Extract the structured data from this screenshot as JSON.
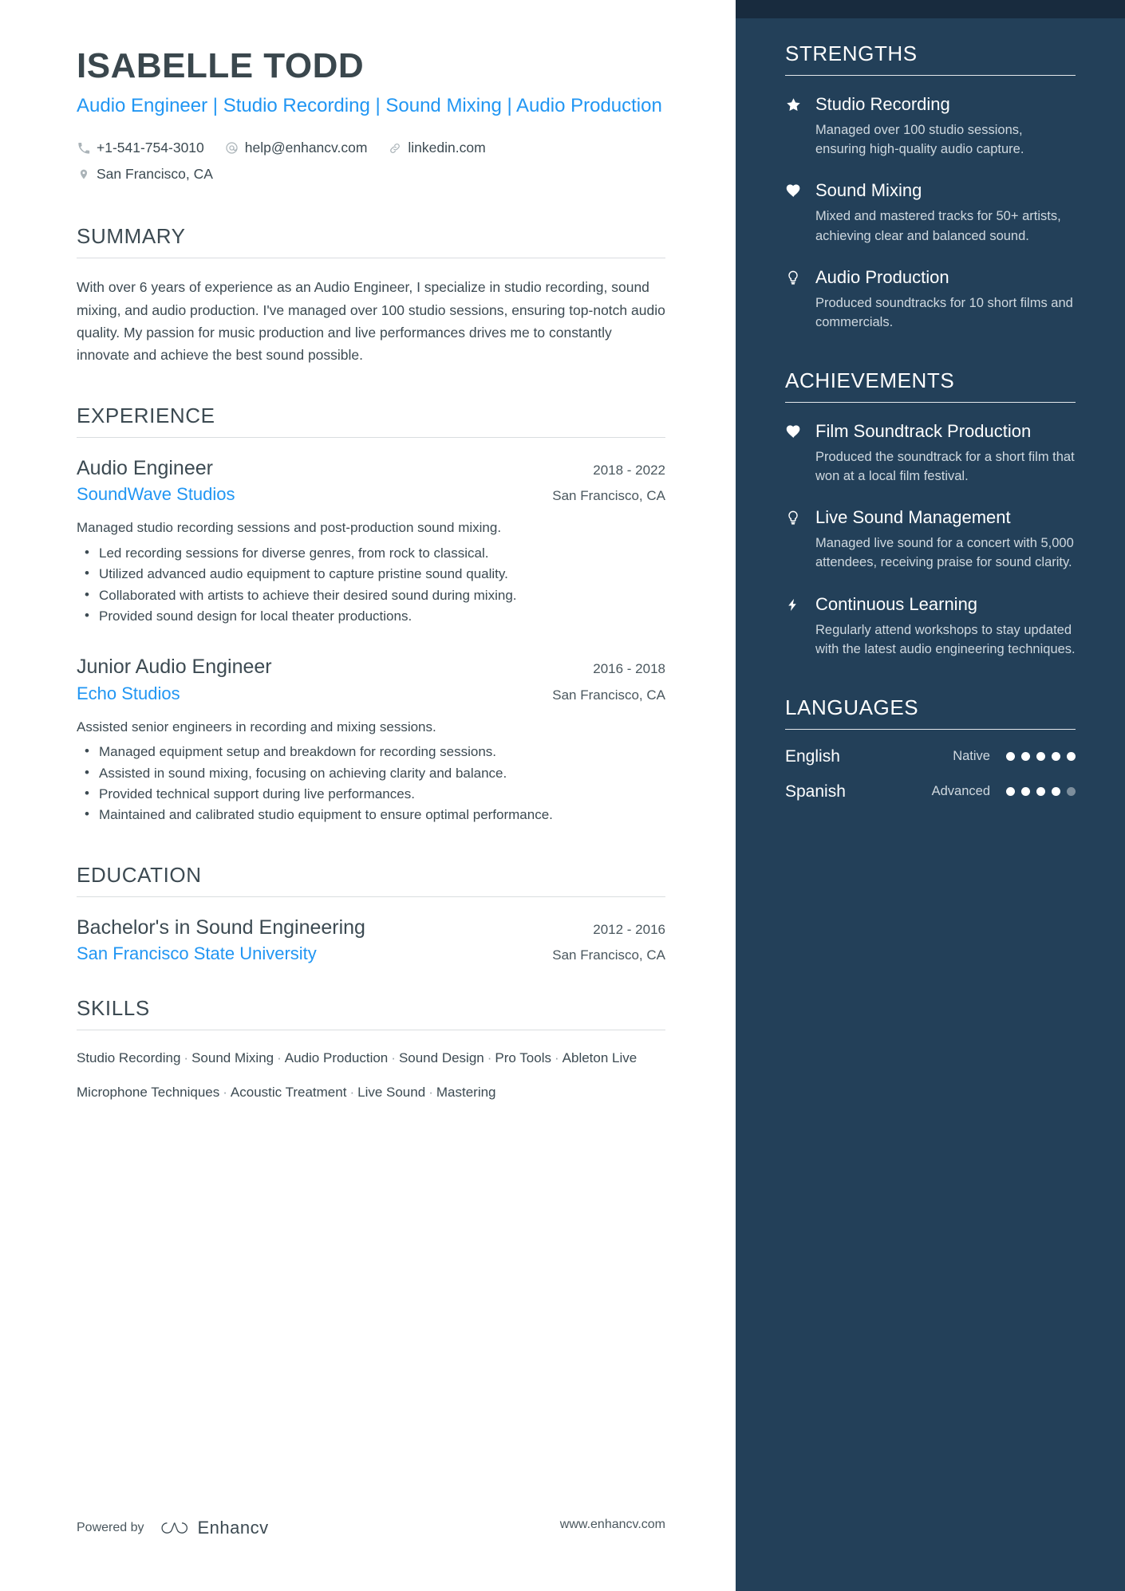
{
  "header": {
    "name": "ISABELLE TODD",
    "headline": "Audio Engineer | Studio Recording | Sound Mixing | Audio Production",
    "contacts_line1": [
      {
        "icon": "phone-icon",
        "text": "+1-541-754-3010"
      },
      {
        "icon": "email-icon",
        "text": "help@enhancv.com"
      },
      {
        "icon": "link-icon",
        "text": "linkedin.com"
      }
    ],
    "contacts_line2": [
      {
        "icon": "location-pin-icon",
        "text": "San Francisco, CA"
      }
    ]
  },
  "summary": {
    "title": "SUMMARY",
    "text": "With over 6 years of experience as an Audio Engineer, I specialize in studio recording, sound mixing, and audio production. I've managed over 100 studio sessions, ensuring top-notch audio quality. My passion for music production and live performances drives me to constantly innovate and achieve the best sound possible."
  },
  "experience": {
    "title": "EXPERIENCE",
    "entries": [
      {
        "role": "Audio Engineer",
        "dates": "2018 - 2022",
        "company": "SoundWave Studios",
        "location": "San Francisco, CA",
        "description": "Managed studio recording sessions and post-production sound mixing.",
        "bullets": [
          "Led recording sessions for diverse genres, from rock to classical.",
          "Utilized advanced audio equipment to capture pristine sound quality.",
          "Collaborated with artists to achieve their desired sound during mixing.",
          "Provided sound design for local theater productions."
        ]
      },
      {
        "role": "Junior Audio Engineer",
        "dates": "2016 - 2018",
        "company": "Echo Studios",
        "location": "San Francisco, CA",
        "description": "Assisted senior engineers in recording and mixing sessions.",
        "bullets": [
          "Managed equipment setup and breakdown for recording sessions.",
          "Assisted in sound mixing, focusing on achieving clarity and balance.",
          "Provided technical support during live performances.",
          "Maintained and calibrated studio equipment to ensure optimal performance."
        ]
      }
    ]
  },
  "education": {
    "title": "EDUCATION",
    "entries": [
      {
        "degree": "Bachelor's in Sound Engineering",
        "dates": "2012 - 2016",
        "school": "San Francisco State University",
        "location": "San Francisco, CA"
      }
    ]
  },
  "skills": {
    "title": "SKILLS",
    "rows": [
      [
        "Studio Recording",
        "Sound Mixing",
        "Audio Production",
        "Sound Design",
        "Pro Tools",
        "Ableton Live"
      ],
      [
        "Microphone Techniques",
        "Acoustic Treatment",
        "Live Sound",
        "Mastering"
      ]
    ],
    "separator": "·"
  },
  "strengths": {
    "title": "STRENGTHS",
    "items": [
      {
        "icon": "star-icon",
        "title": "Studio Recording",
        "description": "Managed over 100 studio sessions, ensuring high-quality audio capture."
      },
      {
        "icon": "heart-icon",
        "title": "Sound Mixing",
        "description": "Mixed and mastered tracks for 50+ artists, achieving clear and balanced sound."
      },
      {
        "icon": "lightbulb-icon",
        "title": "Audio Production",
        "description": "Produced soundtracks for 10 short films and commercials."
      }
    ]
  },
  "achievements": {
    "title": "ACHIEVEMENTS",
    "items": [
      {
        "icon": "heart-icon",
        "title": "Film Soundtrack Production",
        "description": "Produced the soundtrack for a short film that won at a local film festival."
      },
      {
        "icon": "lightbulb-icon",
        "title": "Live Sound Management",
        "description": "Managed live sound for a concert with 5,000 attendees, receiving praise for sound clarity."
      },
      {
        "icon": "bolt-icon",
        "title": "Continuous Learning",
        "description": "Regularly attend workshops to stay updated with the latest audio engineering techniques."
      }
    ]
  },
  "languages": {
    "title": "LANGUAGES",
    "items": [
      {
        "name": "English",
        "level": "Native",
        "filled": 5,
        "total": 5
      },
      {
        "name": "Spanish",
        "level": "Advanced",
        "filled": 4,
        "total": 5
      }
    ]
  },
  "footer": {
    "powered_by": "Powered by",
    "brand": "Enhancv",
    "url": "www.enhancv.com"
  },
  "colors": {
    "accent_blue": "#2196f3",
    "sidebar_navy": "#234059",
    "sidebar_cap_navy": "#182b3e",
    "text_dark": "#3c4a52"
  }
}
